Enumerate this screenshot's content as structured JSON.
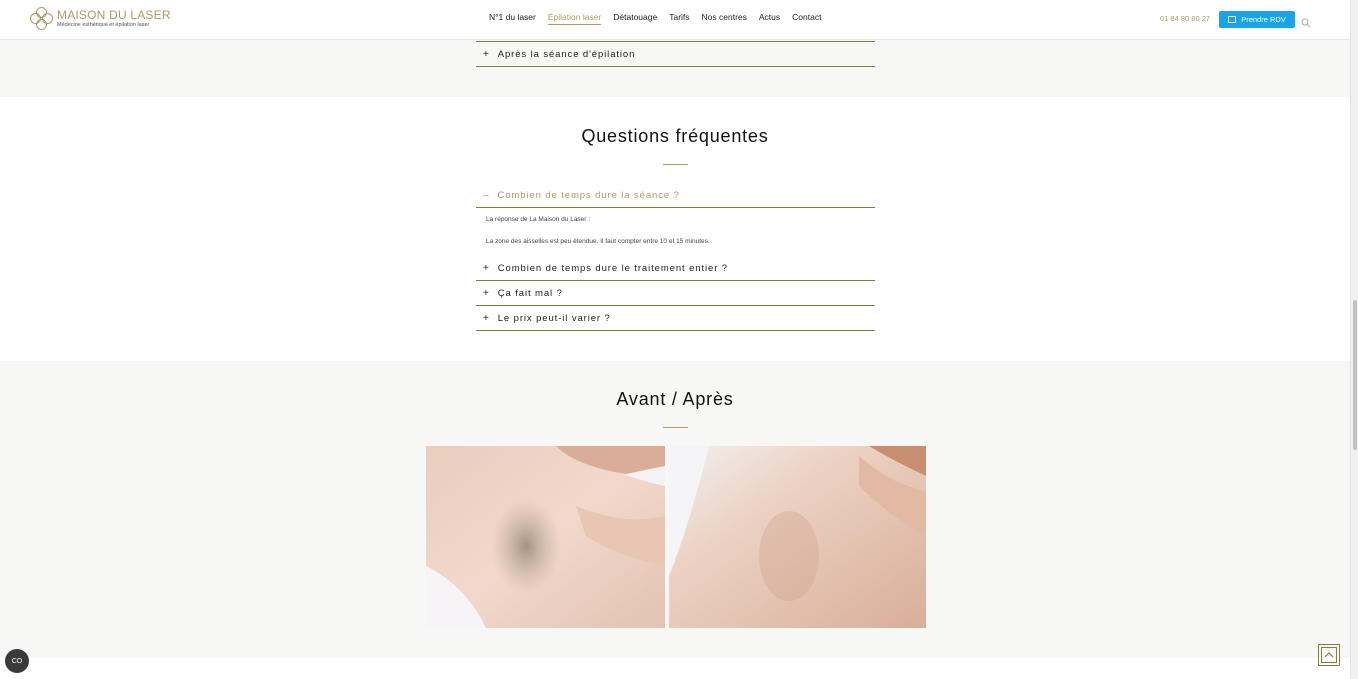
{
  "header": {
    "logo_title": "MAISON DU LASER",
    "logo_subtitle": "Médecine esthétique et épilation laser",
    "nav": [
      "N°1 du laser",
      "Épilation laser",
      "Détatouage",
      "Tarifs",
      "Nos centres",
      "Actus",
      "Contact"
    ],
    "active_nav": "Épilation laser",
    "phone": "01 84 80 80 27",
    "cta": "Prendre RDV",
    "accent_color": "#b09a66",
    "cta_color": "#1aa3e6"
  },
  "top_section": {
    "accordion_item": "Après la séance d'épilation"
  },
  "faq": {
    "title": "Questions fréquentes",
    "open_item": {
      "sign": "–",
      "question": "Combien de temps dure la séance ?",
      "answer_intro": "La réponse de La Maison du Laser :",
      "answer": "La zone des aisselles est peu étendue. Il faut compter entre 10 et 15 minutes."
    },
    "items": [
      {
        "sign": "+",
        "question": "Combien de temps dure le traitement entier ?"
      },
      {
        "sign": "+",
        "question": "Ça fait mal ?"
      },
      {
        "sign": "+",
        "question": "Le prix peut-il varier ?"
      }
    ]
  },
  "before_after": {
    "title": "Avant / Après"
  },
  "icons": {
    "search": "search-icon",
    "calendar": "calendar-icon",
    "cookie": "cookie-icon",
    "cookie_glyph": "CO",
    "back_to_top": "chevron-up-icon"
  },
  "accordion_plus": "+"
}
